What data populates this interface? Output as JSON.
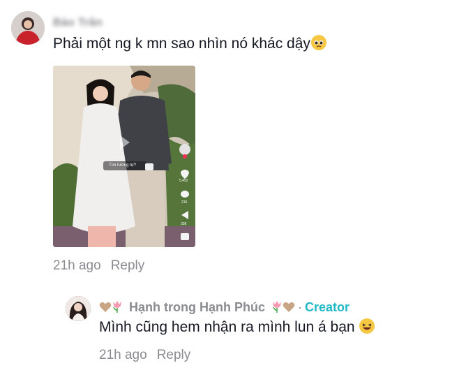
{
  "comment": {
    "username": "Bảo Trân",
    "text": "Phải một ng k mn sao nhìn nó khác dậy",
    "time": "21h ago",
    "reply_label": "Reply"
  },
  "media": {
    "caption": "Tìm tương tự?",
    "like_count": "5,452",
    "comment_count": "215",
    "share_count": "338"
  },
  "reply": {
    "name": "Hạnh trong Hạnh Phúc",
    "separator": "·",
    "badge": "Creator",
    "text": "Mình cũng hem nhận ra mình lun á bạn",
    "time": "21h ago",
    "reply_label": "Reply"
  },
  "colors": {
    "muted": "#8a8b91",
    "creator_accent": "#20b8c7",
    "text": "#161823"
  }
}
